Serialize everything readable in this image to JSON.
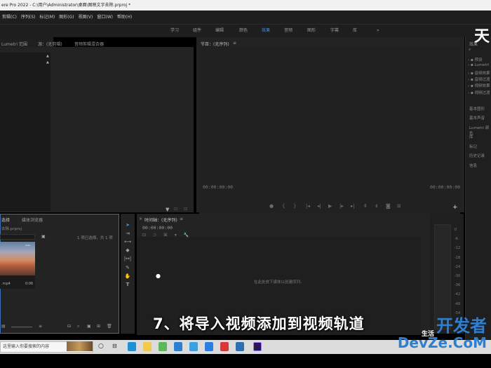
{
  "window": {
    "title": "ere Pro 2022 - C:\\用户\\Administrator\\桌面\\图映文字去除.prproj *"
  },
  "menu": [
    "剪辑(C)",
    "序列(S)",
    "标记(M)",
    "图形(G)",
    "视图(V)",
    "窗口(W)",
    "帮助(H)"
  ],
  "workspaces": [
    "学习",
    "组件",
    "编辑",
    "颜色",
    "效果",
    "音频",
    "图形",
    "字幕",
    "库",
    "»"
  ],
  "workspace_active": "效果",
  "left_top_panel": {
    "tabs": [
      "Lumetri 范围",
      "源：(无剪辑)",
      "音频剪辑混合器"
    ]
  },
  "program_monitor": {
    "title": "节目：(无序列)",
    "timecode_left": "00:00:00:00",
    "timecode_right": "00:00:00:00"
  },
  "right_panel": {
    "side_label": "天",
    "header": "效果",
    "tree": [
      "预设",
      "Lumetri",
      "音频效果",
      "音频过渡",
      "视频效果",
      "视频过渡"
    ],
    "items": [
      "基本图形",
      "基本声音",
      "Lumetri 颜色",
      "库",
      "标记",
      "历史记录",
      "信息"
    ]
  },
  "project_panel": {
    "tabs": [
      "选择",
      "媒体浏览器"
    ],
    "project_file": "去除.prproj",
    "selection_info": "1 项已选择，共 1 项",
    "clip_name": ".mp4",
    "clip_duration": "0:06"
  },
  "timeline": {
    "title": "时间轴：(无序列)",
    "timecode": "00:00:00:00",
    "drop_hint": "在此处放下媒体以创建序列。"
  },
  "meter_labels": [
    "0",
    "-6",
    "-12",
    "-18",
    "-24",
    "-30",
    "-36",
    "-42",
    "-48",
    "-54"
  ],
  "caption": "7、将导入视频添加到视频轨道",
  "taskbar": {
    "search_placeholder": "这里输入你要搜索的内容"
  },
  "watermark": {
    "line1": "开发者",
    "line2": "DevZe.CoM",
    "small": "生活"
  }
}
